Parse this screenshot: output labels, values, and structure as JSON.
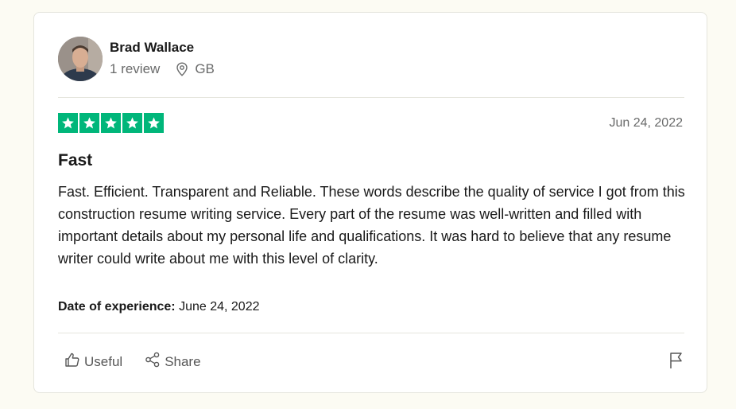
{
  "reviewer": {
    "name": "Brad Wallace",
    "review_count": "1 review",
    "country": "GB",
    "avatar_icon": "profile-photo"
  },
  "review": {
    "rating": 5,
    "rating_max": 5,
    "star_color": "#00b67a",
    "date": "Jun 24, 2022",
    "title": "Fast",
    "body": "Fast. Efficient. Transparent and Reliable. These words describe the quality of service I got from this construction resume writing service. Every part of the resume was well-written and filled with important details about my personal life and qualifications. It was hard to believe that any resume writer could write about me with this level of clarity.",
    "experience_label": "Date of experience:",
    "experience_date": "June 24, 2022"
  },
  "actions": {
    "useful_label": "Useful",
    "useful_icon": "thumbs-up-icon",
    "share_label": "Share",
    "share_icon": "share-icon",
    "flag_icon": "flag-icon"
  }
}
